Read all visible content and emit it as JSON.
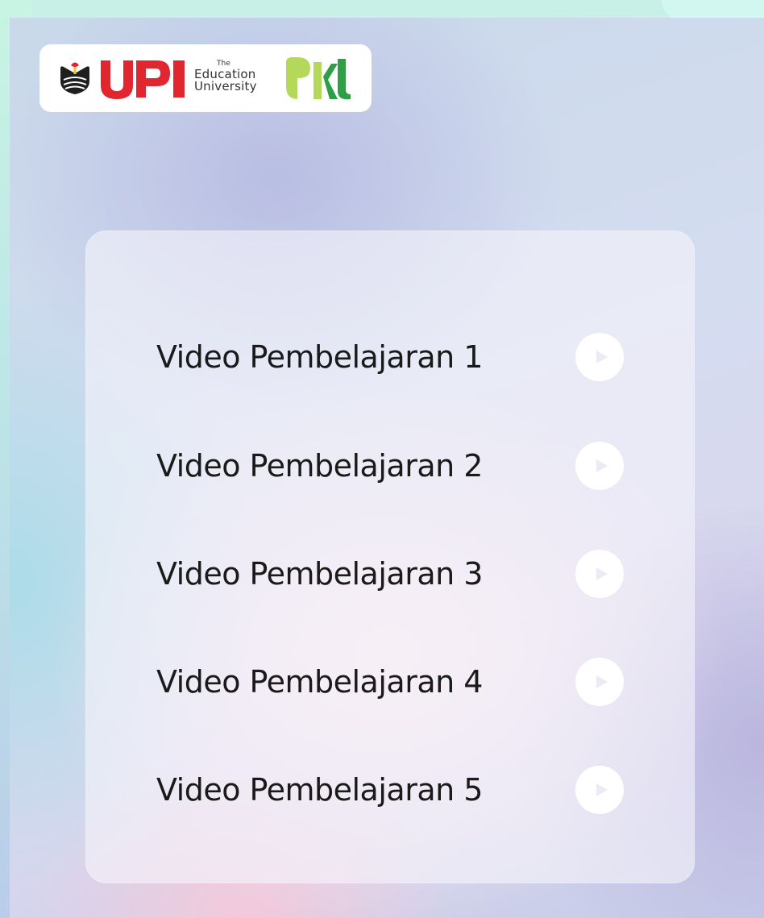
{
  "header": {
    "brand_name": "UPI",
    "edu_the": "The",
    "edu_line1": "Education",
    "edu_line2": "University",
    "partner_logo": "PKL"
  },
  "videos": {
    "items": [
      {
        "label": "Video Pembelajaran 1",
        "icon": "play-icon"
      },
      {
        "label": "Video Pembelajaran 2",
        "icon": "play-icon"
      },
      {
        "label": "Video Pembelajaran 3",
        "icon": "play-icon"
      },
      {
        "label": "Video Pembelajaran 4",
        "icon": "play-icon"
      },
      {
        "label": "Video Pembelajaran 5",
        "icon": "play-icon"
      }
    ]
  },
  "colors": {
    "upi_red": "#e0262f",
    "pkl_green_light": "#b4d95a",
    "pkl_green_dark": "#2e9e47",
    "play_icon": "#eceaf2",
    "text": "#1a1a1a"
  }
}
